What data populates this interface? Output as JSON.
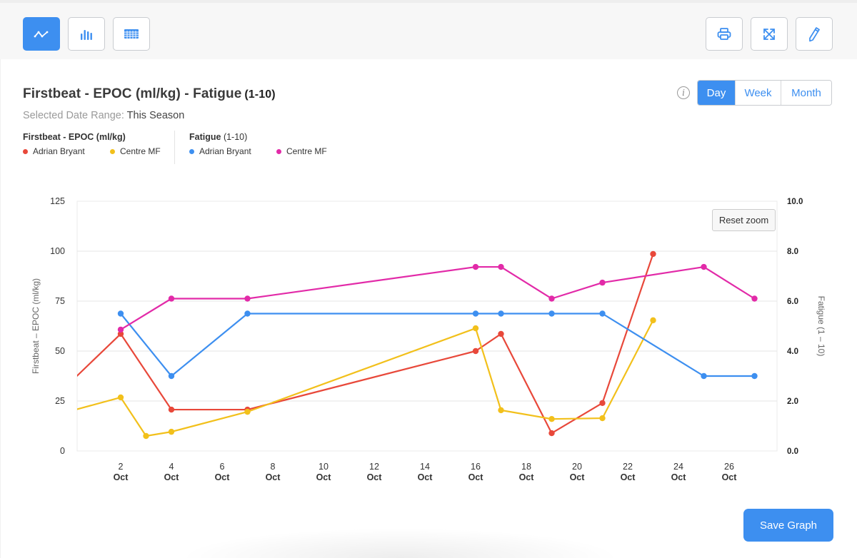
{
  "toolbar": {
    "left": [
      {
        "name": "line-chart",
        "icon": "line-chart-icon",
        "active": true
      },
      {
        "name": "bar-chart",
        "icon": "bar-chart-icon",
        "active": false
      },
      {
        "name": "table-view",
        "icon": "table-icon",
        "active": false
      }
    ],
    "right": [
      {
        "name": "print",
        "icon": "print-icon"
      },
      {
        "name": "fullscreen",
        "icon": "expand-icon"
      },
      {
        "name": "edit",
        "icon": "pencil-icon"
      }
    ]
  },
  "header": {
    "title_main": "Firstbeat - EPOC (ml/kg)  - Fatigue",
    "title_unit": "(1-10)",
    "date_range_label": "Selected Date Range:",
    "date_range_value": "This Season"
  },
  "period": {
    "options": [
      "Day",
      "Week",
      "Month"
    ],
    "selected": "Day"
  },
  "legend": {
    "groups": [
      {
        "title": "Firstbeat - EPOC (ml/kg)",
        "title_unit": "",
        "items": [
          {
            "label": "Adrian Bryant",
            "color": "#e8483a"
          },
          {
            "label": "Centre MF",
            "color": "#f2c01b"
          }
        ]
      },
      {
        "title": "Fatigue",
        "title_unit": "(1-10)",
        "items": [
          {
            "label": "Adrian Bryant",
            "color": "#3d8ff0"
          },
          {
            "label": "Centre MF",
            "color": "#e22aa8"
          }
        ]
      }
    ]
  },
  "buttons": {
    "reset_zoom": "Reset zoom",
    "save_graph": "Save Graph"
  },
  "chart_data": {
    "type": "line",
    "title": "Firstbeat - EPOC (ml/kg) - Fatigue (1-10)",
    "x_unit": "day of October",
    "x_range": [
      0.28,
      28.3
    ],
    "x_ticks": [
      {
        "value": 2,
        "day": "2",
        "month": "Oct"
      },
      {
        "value": 4,
        "day": "4",
        "month": "Oct"
      },
      {
        "value": 6,
        "day": "6",
        "month": "Oct"
      },
      {
        "value": 8,
        "day": "8",
        "month": "Oct"
      },
      {
        "value": 10,
        "day": "10",
        "month": "Oct"
      },
      {
        "value": 12,
        "day": "12",
        "month": "Oct"
      },
      {
        "value": 14,
        "day": "14",
        "month": "Oct"
      },
      {
        "value": 16,
        "day": "16",
        "month": "Oct"
      },
      {
        "value": 18,
        "day": "18",
        "month": "Oct"
      },
      {
        "value": 20,
        "day": "20",
        "month": "Oct"
      },
      {
        "value": 22,
        "day": "22",
        "month": "Oct"
      },
      {
        "value": 24,
        "day": "24",
        "month": "Oct"
      },
      {
        "value": 26,
        "day": "26",
        "month": "Oct"
      }
    ],
    "y_left": {
      "label": "Firstbeat – EPOC (ml/kg)",
      "range": [
        0,
        125
      ],
      "ticks": [
        "0",
        "25",
        "50",
        "75",
        "100",
        "125"
      ],
      "tick_values": [
        0,
        25,
        50,
        75,
        100,
        125
      ]
    },
    "y_right": {
      "label": "Fatigue (1 – 10)",
      "range": [
        0,
        10
      ],
      "ticks": [
        "0.0",
        "2.0",
        "4.0",
        "6.0",
        "8.0",
        "10.0"
      ],
      "tick_values": [
        0,
        2,
        4,
        6,
        8,
        10
      ]
    },
    "grid": true,
    "series": [
      {
        "name": "Firstbeat - EPOC (ml/kg) – Adrian Bryant",
        "axis": "left",
        "color": "#e8483a",
        "points": [
          [
            -1,
            22,
            false
          ],
          [
            2,
            58.6,
            true
          ],
          [
            4,
            20.7,
            true
          ],
          [
            7,
            20.7,
            true
          ],
          [
            16,
            50,
            true
          ],
          [
            17,
            58.6,
            true
          ],
          [
            19,
            8.9,
            true
          ],
          [
            21,
            24,
            true
          ],
          [
            23,
            98.6,
            true
          ]
        ]
      },
      {
        "name": "Firstbeat - EPOC (ml/kg) – Centre MF",
        "axis": "left",
        "color": "#f2c01b",
        "points": [
          [
            -1,
            16.5,
            false
          ],
          [
            2,
            26.8,
            true
          ],
          [
            3,
            7.5,
            true
          ],
          [
            4,
            9.6,
            true
          ],
          [
            7,
            19.6,
            true
          ],
          [
            16,
            61.4,
            true
          ],
          [
            17,
            20.4,
            true
          ],
          [
            19,
            16,
            true
          ],
          [
            21,
            16.4,
            true
          ],
          [
            23,
            65.4,
            true
          ]
        ]
      },
      {
        "name": "Fatigue (1-10) – Adrian Bryant",
        "axis": "right",
        "color": "#3d8ff0",
        "points": [
          [
            2,
            5.5,
            true
          ],
          [
            4,
            3.0,
            true
          ],
          [
            7,
            5.5,
            true
          ],
          [
            16,
            5.5,
            true
          ],
          [
            17,
            5.5,
            true
          ],
          [
            19,
            5.5,
            true
          ],
          [
            21,
            5.5,
            true
          ],
          [
            25,
            3.0,
            true
          ],
          [
            27,
            3.0,
            true
          ]
        ]
      },
      {
        "name": "Fatigue (1-10) – Centre MF",
        "axis": "right",
        "color": "#e22aa8",
        "points": [
          [
            2,
            4.86,
            true
          ],
          [
            4,
            6.1,
            true
          ],
          [
            7,
            6.1,
            true
          ],
          [
            16,
            7.37,
            true
          ],
          [
            17,
            7.37,
            true
          ],
          [
            19,
            6.1,
            true
          ],
          [
            21,
            6.74,
            true
          ],
          [
            25,
            7.37,
            true
          ],
          [
            27,
            6.1,
            true
          ]
        ]
      }
    ]
  }
}
